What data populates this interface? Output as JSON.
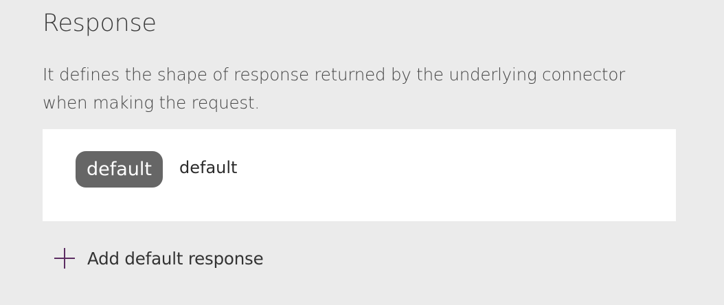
{
  "section": {
    "title": "Response",
    "description": "It defines the shape of response returned by the underlying connector when making the request."
  },
  "responses": [
    {
      "badge": "default",
      "label": "default"
    }
  ],
  "actions": {
    "add_label": "Add default response",
    "add_icon": "plus-icon",
    "accent_color": "#5c2d62"
  },
  "colors": {
    "page_background": "#ebebeb",
    "card_background": "#ffffff",
    "badge_background": "#666666"
  }
}
